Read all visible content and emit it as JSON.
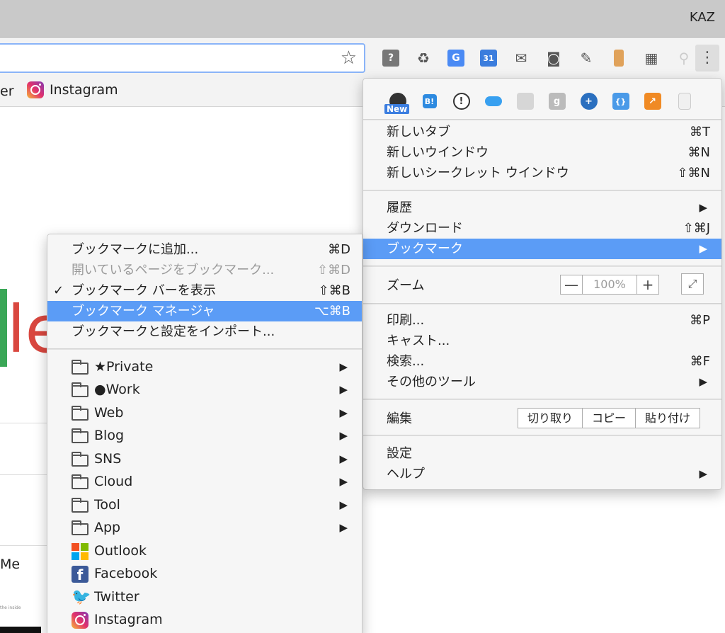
{
  "window": {
    "profile_name": "KAZ"
  },
  "bookmarks_bar": {
    "partial_item": "er",
    "instagram": "Instagram"
  },
  "main_menu": {
    "extensions_new_badge": "New",
    "items": {
      "new_tab": {
        "label": "新しいタブ",
        "shortcut": "⌘T"
      },
      "new_window": {
        "label": "新しいウインドウ",
        "shortcut": "⌘N"
      },
      "new_incognito": {
        "label": "新しいシークレット ウインドウ",
        "shortcut": "⇧⌘N"
      },
      "history": {
        "label": "履歴"
      },
      "downloads": {
        "label": "ダウンロード",
        "shortcut": "⇧⌘J"
      },
      "bookmarks": {
        "label": "ブックマーク"
      },
      "zoom": {
        "label": "ズーム",
        "minus": "—",
        "value": "100%",
        "plus": "+"
      },
      "print": {
        "label": "印刷...",
        "shortcut": "⌘P"
      },
      "cast": {
        "label": "キャスト..."
      },
      "find": {
        "label": "検索...",
        "shortcut": "⌘F"
      },
      "more_tools": {
        "label": "その他のツール"
      },
      "edit": {
        "label": "編集",
        "cut": "切り取り",
        "copy": "コピー",
        "paste": "貼り付け"
      },
      "settings": {
        "label": "設定"
      },
      "help": {
        "label": "ヘルプ"
      }
    },
    "arrow": "▶"
  },
  "bookmarks_submenu": {
    "add": {
      "label": "ブックマークに追加...",
      "shortcut": "⌘D"
    },
    "bookmark_open_pages": {
      "label": "開いているページをブックマーク...",
      "shortcut": "⇧⌘D"
    },
    "show_bar": {
      "label": "ブックマーク バーを表示",
      "shortcut": "⇧⌘B",
      "check": "✓"
    },
    "manager": {
      "label": "ブックマーク マネージャ",
      "shortcut": "⌥⌘B"
    },
    "import": {
      "label": "ブックマークと設定をインポート..."
    },
    "folders": [
      "★Private",
      "●Work",
      "Web",
      "Blog",
      "SNS",
      "Cloud",
      "Tool",
      "App"
    ],
    "links": {
      "outlook": "Outlook",
      "facebook": "Facebook",
      "twitter": "Twitter",
      "instagram": "Instagram"
    },
    "arrow": "▶"
  },
  "page": {
    "partial_word": "le",
    "me_text": "Me",
    "tiny_caption": "the inside"
  },
  "colors": {
    "highlight": "#5b9cf6",
    "google_red": "#d9473f",
    "google_green": "#3aa757"
  }
}
